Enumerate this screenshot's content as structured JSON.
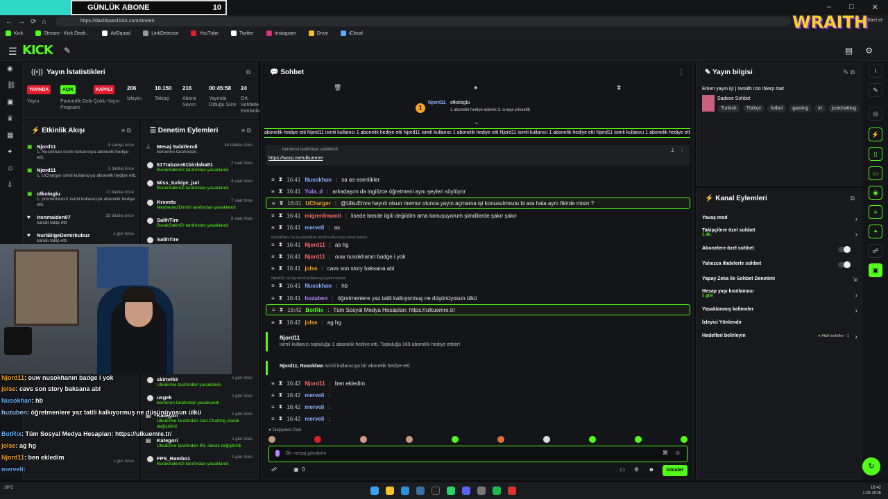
{
  "browser": {
    "sub_goal_label": "GÜNLÜK ABONE",
    "sub_goal_value": "10",
    "url": "https://dashboard.kick.com/stream",
    "top_right": "Sohbet et",
    "bookmarks": [
      "Kick",
      "Stream - Kick Dash...",
      "AdSquad",
      "LinkDetector",
      "YouTube",
      "Twitter",
      "Instagram",
      "Drive",
      "iCloud"
    ],
    "sponsor_logo": "WRAITH"
  },
  "header": {
    "logo": "KICK"
  },
  "stats": {
    "title": "Yayın İstatistikleri",
    "items": [
      {
        "value": "YAYINDA",
        "label": "Yayın",
        "badge": "red"
      },
      {
        "value": "AÇIK",
        "label": "Partnerlik Gelir Programı",
        "badge": "green"
      },
      {
        "value": "KAPALI",
        "label": "Çoklu Yayın",
        "badge": "red"
      },
      {
        "value": "206",
        "label": "İzleyici"
      },
      {
        "value": "10.150",
        "label": "Takipçi"
      },
      {
        "value": "216",
        "label": "Abone Sayısı"
      },
      {
        "value": "00:45:58",
        "label": "Yayında Olduğu Süre"
      },
      {
        "value": "24",
        "label": "Ort. Sohbete Katılanla"
      }
    ]
  },
  "events": {
    "title": "Etkinlik Akışı",
    "items": [
      {
        "name": "Njord11",
        "time": "8 saniye önce",
        "desc": "1, Nusokhan isimli kullanıcıya abonelik hediye etti."
      },
      {
        "name": "Njord11",
        "time": "5 dakika önce",
        "desc": "1, UCharger isimli kullanıcıya abonelik hediye etti."
      },
      {
        "name": "ofkologlu",
        "time": "17 dakika önce",
        "desc": "1, prometheusX isimli kullanıcıya abonelik hediye etti."
      },
      {
        "name": "Ironmaiden07",
        "time": "28 dakika önce",
        "desc": "kanalı takip etti"
      },
      {
        "name": "NuriBilgeDemirkubuz",
        "time": "1 gün önce",
        "desc": "kanalı takip etti"
      },
      {
        "name": "",
        "time": "1 gün önce",
        "desc": ""
      }
    ]
  },
  "audit": {
    "title": "Denetim Eylemleri",
    "items": [
      {
        "name": "Mesaj Sabitlendi",
        "time": "44 dakika önce",
        "desc": "berrennn tarafından"
      },
      {
        "name": "61Trabzon61birdaha81",
        "time": "2 saat önce",
        "desc": "BurakSakinOl tarafından yasaklandı"
      },
      {
        "name": "Miss_turkiye_juri",
        "time": "4 saat önce",
        "desc": "BurakSakinOl tarafından yasaklandı"
      },
      {
        "name": "Krxvets",
        "time": "7 saat önce",
        "desc": "MeyhaneciDimitri tarafından yasaklandı"
      },
      {
        "name": "SalihTire",
        "time": "8 saat önce",
        "desc": "BurakSakinOl tarafından yasaklandı"
      },
      {
        "name": "SalihTire",
        "time": "",
        "desc": ""
      },
      {
        "name": "skirtel53",
        "time": "1 gün önce",
        "desc": "UlkuEmre tarafından yasaklandı"
      },
      {
        "name": "usgek",
        "time": "1 gün önce",
        "desc": "berrennn tarafından yasaklandı"
      },
      {
        "name": "Kategori",
        "time": "1 gün önce",
        "desc": "UlkuEmre tarafından Just Chatting olarak değiştirildi"
      },
      {
        "name": "Kategori",
        "time": "1 gün önce",
        "desc": "UlkuEmre tarafından IRL olarak değiştirildi"
      },
      {
        "name": "FPS_Rambo1",
        "time": "1 gün önce",
        "desc": "BurakSakinOl tarafından yasaklandı"
      }
    ]
  },
  "overlay_chat": [
    {
      "user": "Njord11",
      "text": ": ouw nusokhanın badge i yok"
    },
    {
      "user": "jolse",
      "text": ": cavs son story baksana abi"
    },
    {
      "user": "Nusokhan",
      "text": ": hb"
    },
    {
      "user": "huzuben",
      "text": ": öğretmenlere yaz tatili kalkıyormuş ne düşünüyosun ülkü"
    },
    {
      "user": "BotRix",
      "text": ": Tüm Sosyal Medya Hesapları: https://ulkuemre.tr/"
    },
    {
      "user": "jolse",
      "text": ": ag hg"
    },
    {
      "user": "Njord11",
      "text": ": ben ekledim"
    },
    {
      "user": "merveli",
      "text": ":"
    },
    {
      "user": "merveli",
      "text": ":"
    }
  ],
  "chat": {
    "title": "Sohbet",
    "host": "Njord11",
    "host_sub": "ofkologlu",
    "host_note": "1 abonelik hediye ederek 3. sıraya yükseltti",
    "marquee": "abonelik hediye etti  Njord11 isimli kullanıcı 1 abonelik hediye etti  Njord11 isimli kullanıcı 1 abonelik hediye etti  Njord11 isimli kullanıcı 1 abonelik hediye etti  Njord11 isimli kullanıcı 1 abonelik hediye etti",
    "pinned_by": "berrennn tarafından sabitlendi",
    "pinned_link": "https://worp.me/ulkuemre",
    "messages": [
      {
        "time": "16:41",
        "user": "Nusokhan",
        "text": "sa as esenlikler",
        "color": "#8ab4ff",
        "hl": false
      },
      {
        "time": "16:41",
        "user": "Yula_d",
        "text": "arkadaşım da ingilizce öğretmeni aynı şeyleri söylüyor",
        "color": "#b784ff",
        "hl": false
      },
      {
        "time": "16:41",
        "user": "UCharger",
        "text": "@UlkuEmre hayırlı olsun memur olunca yayın açmama işi konusulmsutu bi ara hala aynı fikirde misin ?",
        "color": "#f6a623",
        "hl": true
      },
      {
        "time": "16:41",
        "user": "migrenlimanti",
        "text": "lisede bende ilgili değildim ama konuşuyorum şimdilerde şakır şakır",
        "color": "#ff6b6b",
        "hl": false
      },
      {
        "time": "16:41",
        "user": "merveli",
        "text": "as",
        "color": "#8ab4ff",
        "hl": false
      },
      {
        "time": "16:41",
        "user": "Njord11",
        "text": "as hg",
        "color": "#ff6b6b",
        "hl": false
      },
      {
        "time": "16:41",
        "user": "Njord11",
        "text": "ouw nusokhanın badge i yok",
        "color": "#ff6b6b",
        "hl": false
      },
      {
        "time": "16:41",
        "user": "jolse",
        "text": "cavs son story baksana abi",
        "color": "#f6a623",
        "hl": false
      },
      {
        "time": "16:41",
        "user": "Nusokhan",
        "text": "hb",
        "color": "#8ab4ff",
        "hl": false
      },
      {
        "time": "16:41",
        "user": "huzuben",
        "text": "öğretmenlere yaz tatili kalkıyormuş ne düşünüyosun ülkü",
        "color": "#b784ff",
        "hl": false
      },
      {
        "time": "16:42",
        "user": "BotRix",
        "text": "Tüm Sosyal Medya Hesapları: https://ulkuemre.tr/",
        "color": "#53fc18",
        "hl": true
      },
      {
        "time": "16:42",
        "user": "jolse",
        "text": "ag hg",
        "color": "#f6a623",
        "hl": false
      }
    ],
    "reply1": "Nusokhan: sa as esenlikler isimli kullanıcıya yanıt veriyor",
    "reply2": "Njord11: as hg isimli kullanıcıya yanıt veriyor",
    "gift1_user": "Njord11",
    "gift1_text": "isimli kullanıcı topluluğa 1 abonelik hediye etti. Topluluğa 169 abonelik hediye ettiler!",
    "gift2_users": "Njord11, Nusokhan",
    "gift2_text": "isimli kullanıcıya bir abonelik hediye etti",
    "messages2": [
      {
        "time": "16:42",
        "user": "Njord11",
        "text": "ben ekledim",
        "color": "#ff6b6b"
      },
      {
        "time": "16:42",
        "user": "merveli",
        "text": "",
        "color": "#8ab4ff"
      },
      {
        "time": "16:42",
        "user": "merveli",
        "text": "",
        "color": "#8ab4ff"
      },
      {
        "time": "16:42",
        "user": "merveli",
        "text": "",
        "color": "#8ab4ff"
      }
    ],
    "subs_only": "Takipçilere Özel",
    "placeholder": "Bir mesaj gönderin",
    "viewer_count": "0",
    "send": "Gönder"
  },
  "info": {
    "title": "Yayın bilgisi",
    "stream_title": "Erken yayın işi | !wraith !zio !blerp #ad",
    "category": "Sadece Sohbet",
    "tags": [
      "Turkish",
      "Türkçe",
      "futbol",
      "gaming",
      "irl",
      "justchatting"
    ]
  },
  "actions": {
    "title": "Kanal Eylemleri",
    "items": [
      {
        "label": "Yavaş mod",
        "sub": "",
        "ctrl": "chev"
      },
      {
        "label": "Takipçilere özel sohbet",
        "sub": "1 dk.",
        "ctrl": "chev"
      },
      {
        "label": "Abonelere özel sohbet",
        "sub": "",
        "ctrl": "toggle"
      },
      {
        "label": "Yalnızca ifadelerle sohbet",
        "sub": "",
        "ctrl": "toggle"
      },
      {
        "label": "Yapay Zeka ile Sohbet Denetimi",
        "sub": "",
        "ctrl": "ext"
      },
      {
        "label": "Hesap yaşı kısıtlaması",
        "sub": "1 gün",
        "ctrl": "chev"
      },
      {
        "label": "Yasaklanmış kelimeler",
        "sub": "",
        "ctrl": "chev"
      },
      {
        "label": "İzleyici Yönlendir",
        "sub": "",
        "ctrl": ""
      },
      {
        "label": "Hedefleri belirleyin",
        "sub": "",
        "ctrl": "chev",
        "extra": "Aktif hedefler · 1"
      }
    ]
  },
  "taskbar": {
    "weather": "18°C",
    "time": "16:42",
    "date": "1.04.2026"
  },
  "colors": {
    "accent": "#53fc18",
    "live": "#e11d2f",
    "bg": "#0e0f11"
  }
}
